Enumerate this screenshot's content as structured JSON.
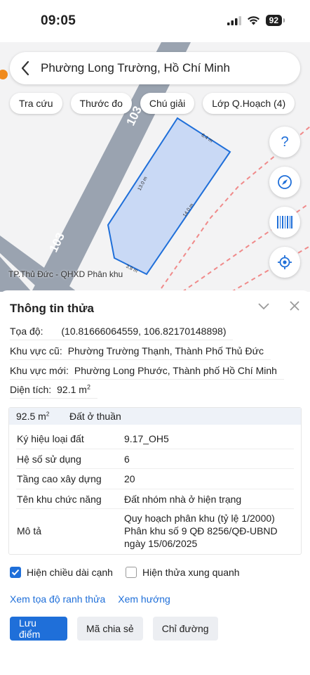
{
  "status": {
    "time": "09:05",
    "battery": "92"
  },
  "search": {
    "title": "Phường Long Trường, Hồ Chí Minh"
  },
  "chips": [
    "Tra cứu",
    "Thước đo",
    "Chú giải",
    "Lớp Q.Hoạch (4)"
  ],
  "map": {
    "caption": "TP.Thủ Đức - QHXD Phân khu",
    "road_labels": [
      "103",
      "103"
    ],
    "edge_labels": [
      "13.0 m",
      "6.4 m",
      "14.0 m",
      "3.8 m"
    ]
  },
  "panel": {
    "title": "Thông tin thửa",
    "coords": {
      "label": "Tọa độ:",
      "value": "(10.81666064559, 106.82170148898)"
    },
    "old_area": {
      "label": "Khu vực cũ:",
      "value": "Phường Trường Thạnh, Thành Phố Thủ Đức"
    },
    "new_area": {
      "label": "Khu vực mới:",
      "value": "Phường Long Phước, Thành phố Hồ Chí Minh"
    },
    "size": {
      "label": "Diện tích:",
      "value": "92.1 m",
      "unit_sup": "2"
    },
    "detail_head": {
      "area": "92.5 m",
      "area_sup": "2",
      "land_type": "Đất ở thuần"
    },
    "rows": [
      {
        "key": "Ký hiệu loại đất",
        "value": "9.17_OH5"
      },
      {
        "key": "Hệ số sử dụng",
        "value": "6"
      },
      {
        "key": "Tầng cao xây dựng",
        "value": "20"
      },
      {
        "key": "Tên khu chức năng",
        "value": "Đất nhóm nhà ở hiện trạng"
      },
      {
        "key": "Mô tả",
        "value": "Quy hoạch phân khu (tỷ lệ 1/2000) Phân khu số 9 QĐ 8256/QĐ-UBND ngày 15/06/2025"
      }
    ],
    "checkboxes": [
      {
        "label": "Hiện chiều dài cạnh",
        "checked": true
      },
      {
        "label": "Hiện thửa xung quanh",
        "checked": false
      }
    ],
    "links": [
      "Xem tọa độ ranh thửa",
      "Xem hướng"
    ],
    "buttons": {
      "save": "Lưu điểm",
      "share": "Mã chia sẻ",
      "directions": "Chỉ đường"
    }
  },
  "colors": {
    "accent": "#1f6fd9",
    "parcel_fill": "#c9d9f5",
    "road": "#9aa3b0",
    "boundary": "#f08a8a"
  }
}
